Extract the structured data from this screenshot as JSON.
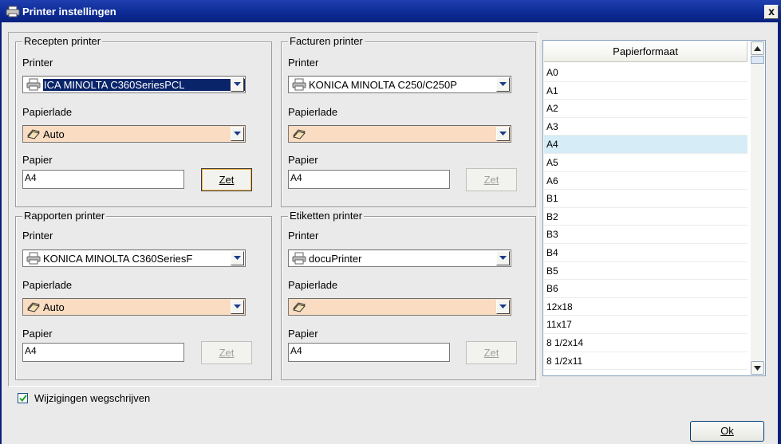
{
  "window": {
    "title": "Printer instellingen",
    "close_label": "x"
  },
  "groups": [
    {
      "legend": "Recepten printer",
      "printer_label": "Printer",
      "printer_value": "ICA MINOLTA C360SeriesPCL",
      "lade_label": "Papierlade",
      "lade_value": "Auto",
      "papier_label": "Papier",
      "papier_value": "A4",
      "zet_label": "Zet"
    },
    {
      "legend": "Facturen printer",
      "printer_label": "Printer",
      "printer_value": "KONICA MINOLTA C250/C250P",
      "lade_label": "Papierlade",
      "lade_value": "",
      "papier_label": "Papier",
      "papier_value": "A4",
      "zet_label": "Zet"
    },
    {
      "legend": "Rapporten printer",
      "printer_label": "Printer",
      "printer_value": "KONICA MINOLTA C360SeriesF",
      "lade_label": "Papierlade",
      "lade_value": "Auto",
      "papier_label": "Papier",
      "papier_value": "A4",
      "zet_label": "Zet"
    },
    {
      "legend": "Etiketten printer",
      "printer_label": "Printer",
      "printer_value": "docuPrinter",
      "lade_label": "Papierlade",
      "lade_value": "",
      "papier_label": "Papier",
      "papier_value": "A4",
      "zet_label": "Zet"
    }
  ],
  "paper_list": {
    "header": "Papierformaat",
    "items": [
      "A0",
      "A1",
      "A2",
      "A3",
      "A4",
      "A5",
      "A6",
      "B1",
      "B2",
      "B3",
      "B4",
      "B5",
      "B6",
      "12x18",
      "11x17",
      "8 1/2x14",
      "8 1/2x11"
    ],
    "selected": "A4"
  },
  "save_checkbox": {
    "label": "Wijzigingen wegschrijven",
    "checked": true
  },
  "ok_label": "Ok",
  "colors": {
    "titlebar": "#0c2a94",
    "tray_field": "#f9dcc2",
    "selection": "#d6ecf7"
  }
}
